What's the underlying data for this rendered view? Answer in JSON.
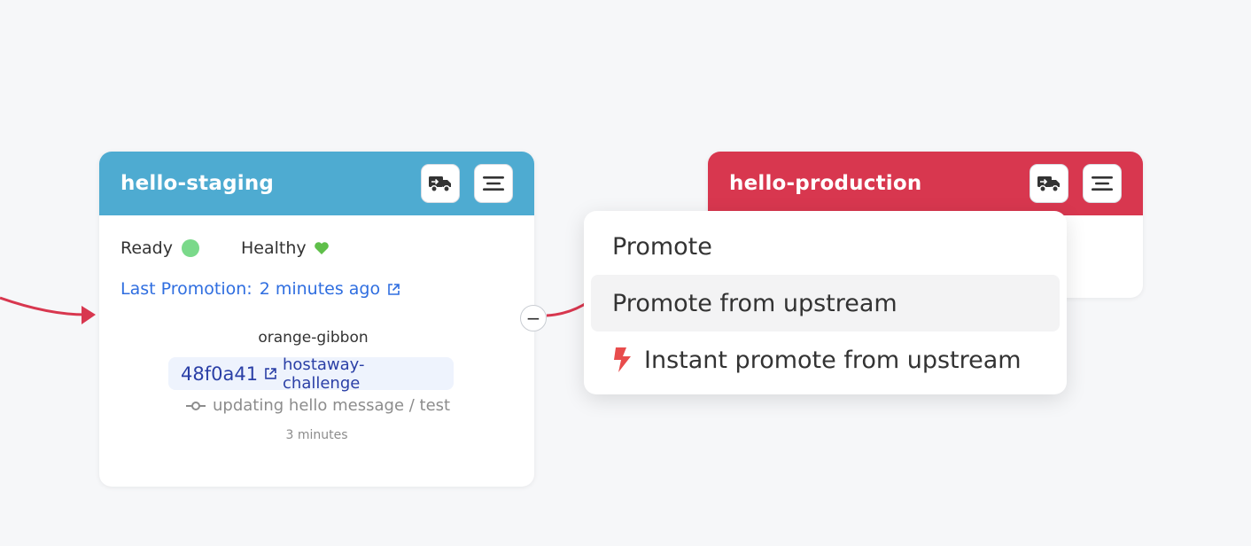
{
  "staging": {
    "title": "hello-staging",
    "header_color": "#4eabd1",
    "status_ready": "Ready",
    "status_healthy": "Healthy",
    "last_promotion_label": "Last Promotion:",
    "last_promotion_time": "2 minutes ago",
    "freight_name": "orange-gibbon",
    "commit_sha": "48f0a41",
    "commit_repo": "hostaway-challenge",
    "commit_message": "updating hello message / test",
    "commit_age": "3 minutes",
    "promote_icon": "truck-icon",
    "menu_icon": "menu-icon"
  },
  "production": {
    "title": "hello-production",
    "header_color": "#d8374f",
    "promote_icon": "truck-icon",
    "menu_icon": "menu-icon"
  },
  "edge": {
    "color": "#d8374f",
    "toggle_symbol": "−"
  },
  "promote_menu": {
    "items": [
      {
        "label": "Promote"
      },
      {
        "label": "Promote from upstream"
      },
      {
        "label": "Instant promote from upstream",
        "icon": "bolt-icon",
        "icon_color": "#e84c4c"
      }
    ]
  }
}
